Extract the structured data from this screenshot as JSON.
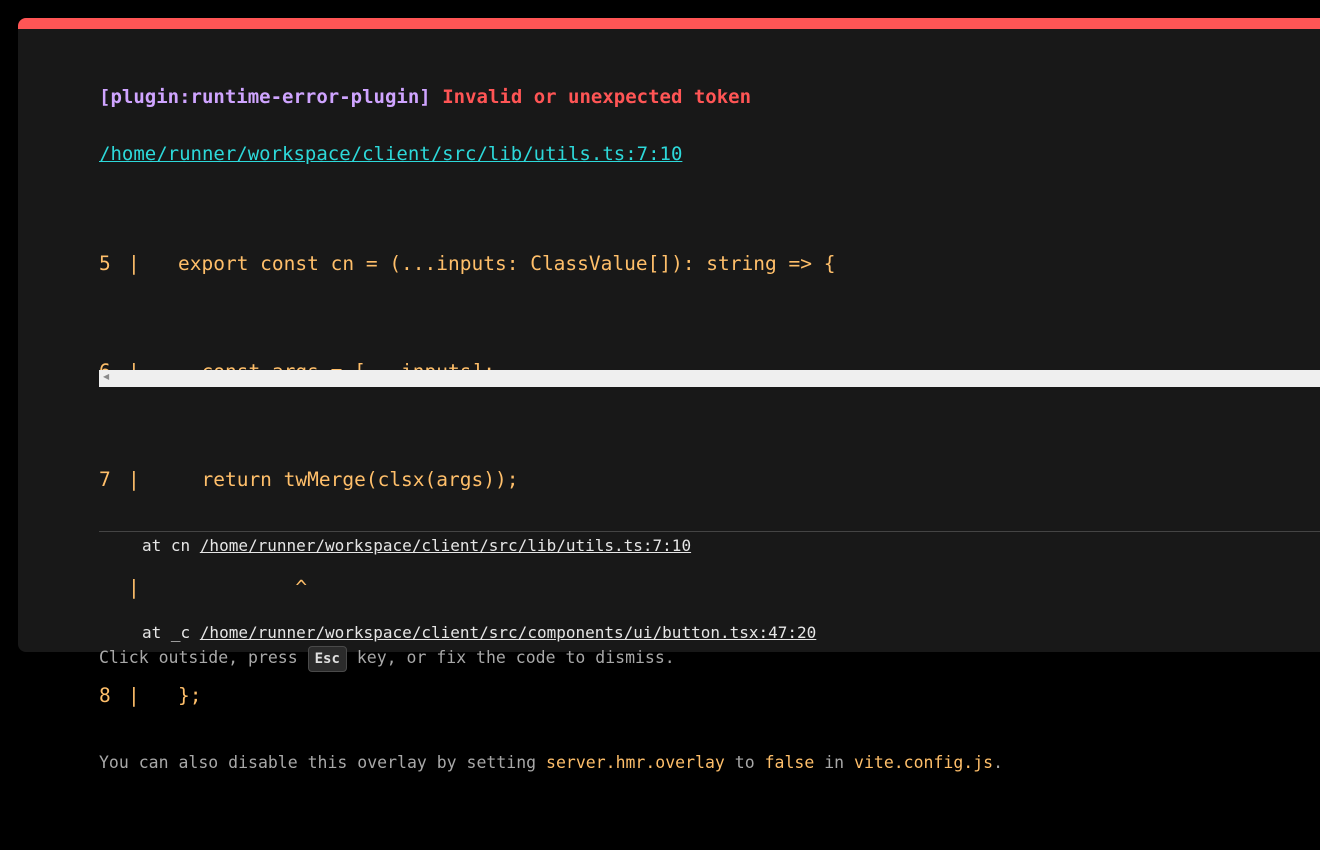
{
  "error": {
    "plugin": "[plugin:runtime-error-plugin]",
    "message": "Invalid or unexpected token",
    "file": "/home/runner/workspace/client/src/lib/utils.ts:7:10",
    "frame": [
      {
        "line": "5",
        "bar": "|",
        "code": "export const cn = (...inputs: ClassValue[]): string => {"
      },
      {
        "line": "6",
        "bar": "|",
        "code": "  const args = [...inputs];"
      },
      {
        "line": "7",
        "bar": "|",
        "code": "  return twMerge(clsx(args));"
      },
      {
        "line": "",
        "bar": "|",
        "code": "          ^"
      },
      {
        "line": "8",
        "bar": "|",
        "code": "};"
      }
    ],
    "stack": [
      {
        "prefix": "at cn ",
        "link": "/home/runner/workspace/client/src/lib/utils.ts:7:10"
      },
      {
        "prefix": "at _c ",
        "link": "/home/runner/workspace/client/src/components/ui/button.tsx:47:20"
      }
    ]
  },
  "tip": {
    "line1_before": "Click outside, press ",
    "esc_key": "Esc",
    "line1_after": " key, or fix the code to dismiss.",
    "line2_before": "You can also disable this overlay by setting ",
    "setting": "server.hmr.overlay",
    "line2_middle": " to ",
    "value": "false",
    "line2_in": " in ",
    "config_file": "vite.config.js",
    "line2_end": "."
  },
  "icons": {
    "scroll_left": "scroll-left-arrow-icon"
  },
  "colors": {
    "accent_bar": "#ff5555",
    "plugin": "#cfa4ff",
    "message": "#ff5555",
    "file_link": "#2dd9da",
    "code": "#ffbf6a",
    "background": "#181818"
  }
}
